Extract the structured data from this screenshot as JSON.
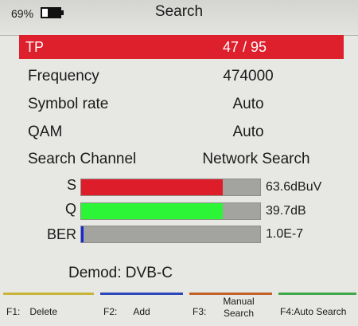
{
  "header": {
    "battery_percent": "69%",
    "battery_level": 0.69,
    "title": "Search"
  },
  "tp": {
    "label": "TP",
    "value": "47 / 95"
  },
  "fields": [
    {
      "label": "Frequency",
      "value": "474000"
    },
    {
      "label": "Symbol rate",
      "value": "Auto"
    },
    {
      "label": "QAM",
      "value": "Auto"
    },
    {
      "label": "Search Channel",
      "value": "Network Search"
    }
  ],
  "meters": [
    {
      "label": "S",
      "value": "63.6dBuV",
      "level": 0.79,
      "color": "#dd1e2a"
    },
    {
      "label": "Q",
      "value": "39.7dB",
      "level": 0.79,
      "color": "#2cf437"
    },
    {
      "label": "BER",
      "value": "1.0E-7",
      "level": 0.01,
      "color": "#1427d6"
    }
  ],
  "demod": "Demod: DVB-C",
  "function_keys": [
    {
      "key": "F1:",
      "label": "Delete",
      "color": "#c9b43a"
    },
    {
      "key": "F2:",
      "label": "Add",
      "color": "#2d49b7"
    },
    {
      "key": "F3:",
      "label": "Manual Search",
      "color": "#c0622a"
    },
    {
      "key": "",
      "label": "F4:Auto Search",
      "color": "#3fa84a"
    }
  ]
}
